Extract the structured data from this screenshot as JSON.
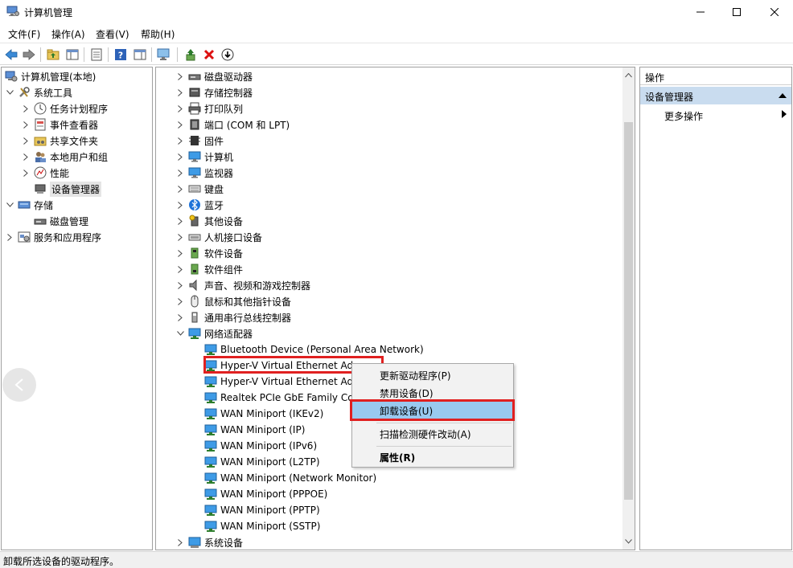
{
  "window": {
    "title": "计算机管理"
  },
  "menubar": [
    "文件(F)",
    "操作(A)",
    "查看(V)",
    "帮助(H)"
  ],
  "left_tree": [
    {
      "label": "计算机管理(本地)",
      "icon": "computer-management-icon"
    },
    {
      "label": "系统工具",
      "icon": "tools-icon"
    },
    {
      "label": "任务计划程序",
      "icon": "clock-icon"
    },
    {
      "label": "事件查看器",
      "icon": "event-viewer-icon"
    },
    {
      "label": "共享文件夹",
      "icon": "shared-folder-icon"
    },
    {
      "label": "本地用户和组",
      "icon": "users-icon"
    },
    {
      "label": "性能",
      "icon": "performance-icon"
    },
    {
      "label": "设备管理器",
      "icon": "device-manager-icon"
    },
    {
      "label": "存储",
      "icon": "storage-icon"
    },
    {
      "label": "磁盘管理",
      "icon": "disk-icon"
    },
    {
      "label": "服务和应用程序",
      "icon": "services-icon"
    }
  ],
  "device_tree": [
    {
      "label": "磁盘驱动器",
      "icon": "disk-drive-icon"
    },
    {
      "label": "存储控制器",
      "icon": "storage-controller-icon"
    },
    {
      "label": "打印队列",
      "icon": "printer-icon"
    },
    {
      "label": "端口 (COM 和 LPT)",
      "icon": "port-icon"
    },
    {
      "label": "固件",
      "icon": "firmware-icon"
    },
    {
      "label": "计算机",
      "icon": "monitor-icon"
    },
    {
      "label": "监视器",
      "icon": "monitor-icon"
    },
    {
      "label": "键盘",
      "icon": "keyboard-icon"
    },
    {
      "label": "蓝牙",
      "icon": "bluetooth-icon"
    },
    {
      "label": "其他设备",
      "icon": "other-device-icon"
    },
    {
      "label": "人机接口设备",
      "icon": "hid-icon"
    },
    {
      "label": "软件设备",
      "icon": "software-device-icon"
    },
    {
      "label": "软件组件",
      "icon": "software-component-icon"
    },
    {
      "label": "声音、视频和游戏控制器",
      "icon": "speaker-icon"
    },
    {
      "label": "鼠标和其他指针设备",
      "icon": "mouse-icon"
    },
    {
      "label": "通用串行总线控制器",
      "icon": "usb-icon"
    },
    {
      "label": "网络适配器",
      "icon": "network-adapter-icon"
    }
  ],
  "network_adapters": [
    "Bluetooth Device (Personal Area Network)",
    "Hyper-V Virtual Ethernet Ad",
    "Hyper-V Virtual Ethernet Ad",
    "Realtek PCIe GbE Family Co",
    "WAN Miniport (IKEv2)",
    "WAN Miniport (IP)",
    "WAN Miniport (IPv6)",
    "WAN Miniport (L2TP)",
    "WAN Miniport (Network Monitor)",
    "WAN Miniport (PPPOE)",
    "WAN Miniport (PPTP)",
    "WAN Miniport (SSTP)"
  ],
  "last_category": {
    "label": "系统设备",
    "icon": "system-device-icon"
  },
  "actions_pane": {
    "header": "操作",
    "section": "设备管理器",
    "item": "更多操作"
  },
  "context_menu": {
    "update_driver": "更新驱动程序(P)",
    "disable": "禁用设备(D)",
    "uninstall": "卸载设备(U)",
    "scan": "扫描检测硬件改动(A)",
    "properties": "属性(R)"
  },
  "statusbar": {
    "text": "卸载所选设备的驱动程序。"
  },
  "colors": {
    "highlight_border": "#e02020",
    "menu_active": "#99c9ef",
    "section_bg": "#c9dcef"
  }
}
